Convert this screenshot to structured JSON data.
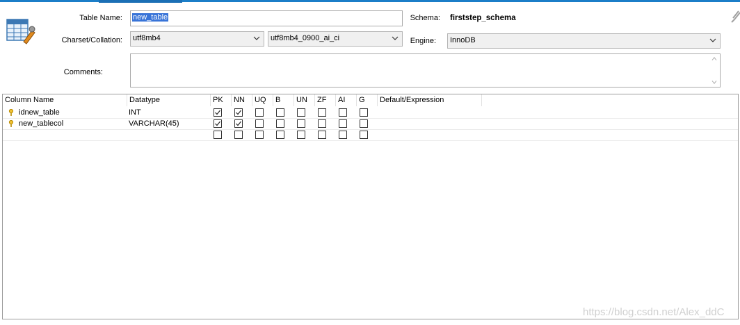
{
  "form": {
    "table_name_label": "Table Name:",
    "table_name_value": "new_table",
    "schema_label": "Schema:",
    "schema_value": "firststep_schema",
    "charset_label": "Charset/Collation:",
    "charset_value": "utf8mb4",
    "collation_value": "utf8mb4_0900_ai_ci",
    "engine_label": "Engine:",
    "engine_value": "InnoDB",
    "comments_label": "Comments:",
    "comments_value": ""
  },
  "grid": {
    "headers": [
      "Column Name",
      "Datatype",
      "PK",
      "NN",
      "UQ",
      "B",
      "UN",
      "ZF",
      "AI",
      "G",
      "Default/Expression"
    ],
    "rows": [
      {
        "name": "idnew_table",
        "datatype": "INT",
        "flags": [
          true,
          true,
          false,
          false,
          false,
          false,
          false,
          false
        ],
        "default": "",
        "key": true
      },
      {
        "name": "new_tablecol",
        "datatype": "VARCHAR(45)",
        "flags": [
          true,
          true,
          false,
          false,
          false,
          false,
          false,
          false
        ],
        "default": "",
        "key": true
      },
      {
        "name": "",
        "datatype": "",
        "flags": [
          false,
          false,
          false,
          false,
          false,
          false,
          false,
          false
        ],
        "default": "",
        "key": false
      }
    ]
  },
  "watermark": "https://blog.csdn.net/Alex_ddC",
  "colors": {
    "accent": "#1b7ec8",
    "selection": "#3874d8"
  }
}
